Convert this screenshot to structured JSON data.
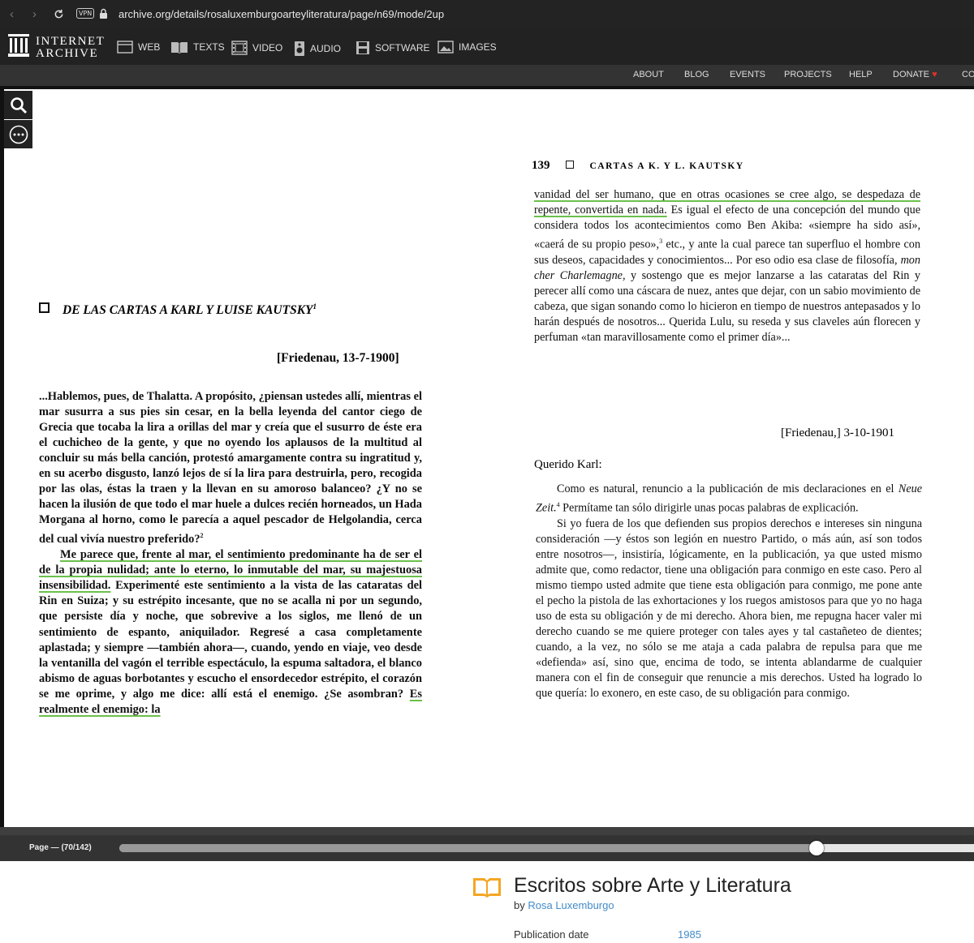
{
  "browser": {
    "url": "archive.org/details/rosaluxemburgoarteyliteratura/page/n69/mode/2up",
    "vpn_label": "VPN"
  },
  "header": {
    "logo_line1": "INTERNET",
    "logo_line2": "ARCHIVE",
    "media": [
      {
        "label": "WEB",
        "icon": "web-icon"
      },
      {
        "label": "TEXTS",
        "icon": "book-icon"
      },
      {
        "label": "VIDEO",
        "icon": "film-icon"
      },
      {
        "label": "AUDIO",
        "icon": "speaker-icon"
      },
      {
        "label": "SOFTWARE",
        "icon": "floppy-icon"
      },
      {
        "label": "IMAGES",
        "icon": "image-icon"
      }
    ],
    "subnav": [
      "ABOUT",
      "BLOG",
      "EVENTS",
      "PROJECTS",
      "HELP",
      "DONATE",
      "CO"
    ]
  },
  "accent": "#e0302b",
  "reader": {
    "left_page": {
      "heading": "DE LAS CARTAS A KARL Y LUISE KAUTSKY",
      "heading_footnote": "1",
      "date": "[Friedenau, 13-7-1900]",
      "p1": "...Hablemos, pues, de Thalatta. A propósito, ¿piensan ustedes allí, mientras el mar susurra a sus pies sin cesar, en la bella leyenda del cantor ciego de Grecia que tocaba la lira a orillas del mar y creía que el susurro de éste era el cuchicheo de la gente, y que no oyendo los aplausos de la multitud al concluir su más bella canción, protestó amargamente contra su ingratitud y, en su acerbo disgusto, lanzó lejos de sí la lira para destruirla, pero, recogida por las olas, éstas la traen y la llevan en su amoroso balanceo? ¿Y no se hacen la ilusión de que todo el mar huele a dulces recién horneados, un Hada Morgana al horno, como le parecía a aquel pescador de Helgolandia, cerca del cual vivía nuestro preferido?",
      "p1_footnote": "2",
      "p2_start": "Me parece que, frente al mar, el sentimiento predominante ha de ser el de la propia nulidad; ante lo eterno, lo inmutable del mar, su majestuosa insensibilidad.",
      "p2_rest": "Experimenté este sentimiento a la vista de las cataratas del Rin en Suiza; y su estrépito incesante, que no se acalla ni por un segundo, que persiste día y noche, que sobrevive a los siglos, me llenó de un sentimiento de espanto, aniquilador. Regresé a casa completamente aplastada; y siempre —también ahora—, cuando, yendo en viaje, veo desde la ventanilla del vagón el terrible espectáculo, la espuma saltadora, el blanco abismo de aguas borbotantes y escucho el ensordecedor estrépito, el corazón se me oprime, y algo me dice: allí está el enemigo. ¿Se asombran?",
      "p2_end": "Es realmente el enemigo: la"
    },
    "right_page": {
      "page_number": "139",
      "running_head": "CARTAS A K. Y L. KAUTSKY",
      "p1_hl": "vanidad del ser humano, que en otras ocasiones se cree algo, se despedaza de repente, convertida en nada.",
      "p1_a": "Es igual el efecto de una concepción del mundo que considera todos los acontecimientos como Ben Akiba: «siempre ha sido así», «caerá de su propio peso»,",
      "p1_fn": "3",
      "p1_b": "etc., y ante la cual parece tan superfluo el hombre con sus deseos, capacidades y conocimientos... Por eso odio esa clase de filosofía,",
      "p1_italic": "mon cher Charlemagne,",
      "p1_c": "y sostengo que es mejor lanzarse a las cataratas del Rin y perecer allí como una cáscara de nuez, antes que dejar, con un sabio movimiento de cabeza, que sigan sonando como lo hicieron en tiempo de nuestros antepasados y lo harán después de nosotros... Querida Lulu, su reseda y sus claveles aún florecen y perfuman «tan maravillosamente como el primer día»...",
      "date": "[Friedenau,] 3-10-1901",
      "salutation": "Querido Karl:",
      "p2_a": "Como es natural, renuncio a la publicación de mis declaraciones en el",
      "p2_italic": "Neue Zeit.",
      "p2_fn": "4",
      "p2_b": "Permítame tan sólo dirigirle unas pocas palabras de explicación.",
      "p3": "Si yo fuera de los que defienden sus propios derechos e intereses sin ninguna consideración —y éstos son legión en nuestro Partido, o más aún, así son todos entre nosotros—, insistiría, lógicamente, en la publicación, ya que usted mismo admite que, como redactor, tiene una obligación para conmigo en este caso. Pero al mismo tiempo usted admite que tiene esta obligación para conmigo, me pone ante el pecho la pistola de las exhortaciones y los ruegos amistosos para que yo no haga uso de esta su obligación y de mi derecho. Ahora bien, me repugna hacer valer mi derecho cuando se me quiere proteger con tales ayes y tal castañeteo de dientes; cuando, a la vez, no sólo se me ataja a cada palabra de repulsa para que me «defienda» así, sino que, encima de todo, se intenta ablandarme de cualquier manera con el fin de conseguir que renuncie a mis derechos. Usted ha logrado lo que quería: lo exonero, en este caso, de su obligación para conmigo."
    },
    "page_label": "Page — (70/142)",
    "progress": 0.81
  },
  "item": {
    "title": "Escritos sobre Arte y Literatura",
    "by_label": "by",
    "author": "Rosa Luxemburgo",
    "pub_label": "Publication date",
    "pub_value": "1985"
  }
}
